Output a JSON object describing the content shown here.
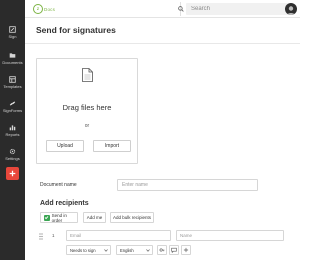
{
  "app": {
    "logo_text": "Docs",
    "search_placeholder": "Search"
  },
  "sidebar": {
    "items": [
      {
        "label": "Sign",
        "icon": "pen-icon"
      },
      {
        "label": "Documents",
        "icon": "folder-icon"
      },
      {
        "label": "Templates",
        "icon": "template-icon"
      },
      {
        "label": "SignForms",
        "icon": "link-icon"
      },
      {
        "label": "Reports",
        "icon": "bar-chart-icon"
      },
      {
        "label": "Settings",
        "icon": "gear-icon"
      }
    ],
    "add_icon": "plus-icon"
  },
  "page": {
    "title": "Send for signatures"
  },
  "upload": {
    "drag_text": "Drag files here",
    "or_text": "or",
    "upload_label": "Upload",
    "import_label": "Import"
  },
  "document": {
    "name_label": "Document name",
    "name_placeholder": "Enter name"
  },
  "recipients": {
    "title": "Add recipients",
    "send_in_order_label": "Send in order",
    "send_in_order_checked": true,
    "add_me_label": "Add me",
    "add_bulk_label": "Add bulk recipients",
    "rows": [
      {
        "number": "1",
        "email_placeholder": "Email",
        "name_placeholder": "Name",
        "role": "Needs to sign",
        "language": "English"
      }
    ]
  },
  "colors": {
    "sidebar_bg": "#2b2b2b",
    "accent_red": "#e8473b",
    "accent_green": "#3aa552",
    "brand_green": "#7bb342"
  }
}
